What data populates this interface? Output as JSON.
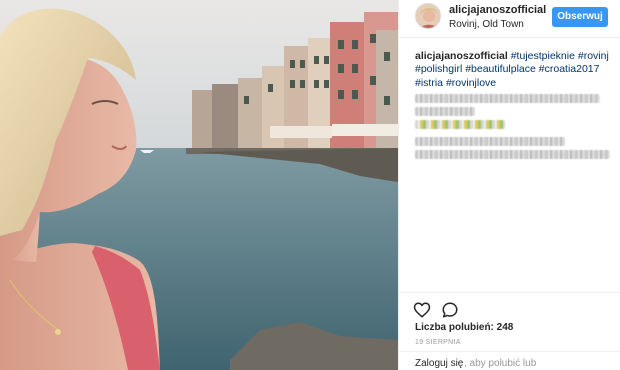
{
  "post": {
    "username": "alicjajanoszofficial",
    "location": "Rovinj, Old Town",
    "follow_label": "Obserwuj"
  },
  "caption": {
    "username": "alicjajanoszofficial",
    "hashtags": [
      "#tujestpieknie",
      "#rovinj",
      "#polishgirl",
      "#beautifulplace",
      "#croatia2017",
      "#istria",
      "#rovinjlove"
    ]
  },
  "actions": {
    "like_icon": "heart-icon",
    "comment_icon": "comment-icon",
    "likes_text": "Liczba polubień: 248",
    "date_text": "19 SIERPNIA"
  },
  "login": {
    "link_label": "Zaloguj się",
    "rest_text": ", aby polubić lub"
  },
  "colors": {
    "follow_button": "#3897f0",
    "hashtag": "#003569",
    "muted": "#999999"
  }
}
